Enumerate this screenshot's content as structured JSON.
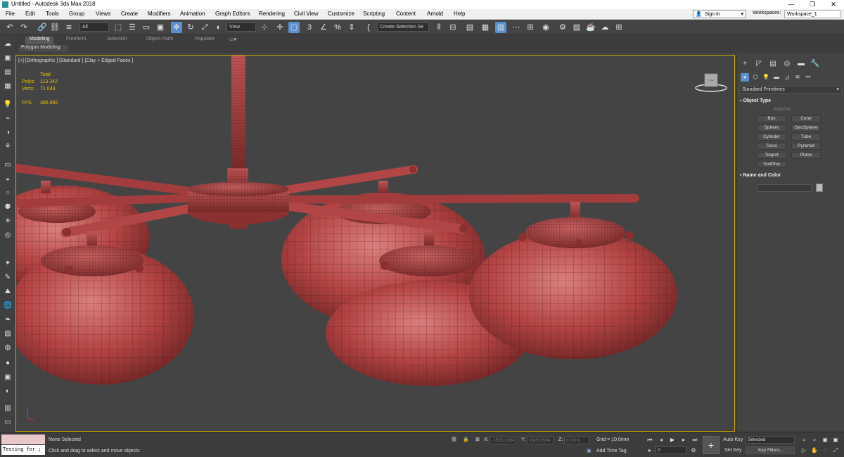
{
  "window": {
    "title": "Untitled - Autodesk 3ds Max 2018",
    "minimize": "—",
    "maximize": "❐",
    "close": "✕"
  },
  "menu": [
    "File",
    "Edit",
    "Tools",
    "Group",
    "Views",
    "Create",
    "Modifiers",
    "Animation",
    "Graph Editors",
    "Rendering",
    "Civil View",
    "Customize",
    "Scripting",
    "Content",
    "Arnold",
    "Help"
  ],
  "account": {
    "signin": "Sign In",
    "workspaces_label": "Workspaces:",
    "workspace": "Workspace_1"
  },
  "toolbar": {
    "selection_filter": "All",
    "ref_coord": "View",
    "named_sel": "Create Selection Se"
  },
  "ribbon": {
    "tabs": [
      "Modeling",
      "Freeform",
      "Selection",
      "Object Paint",
      "Populate"
    ],
    "active": "Modeling",
    "sub": "Polygon Modeling"
  },
  "viewport": {
    "label": "[+] [Orthographic ] [Standard ] [Clay + Edged Faces ]",
    "stats": {
      "total_label": "Total",
      "polys_label": "Polys:",
      "polys": "113 342",
      "verts_label": "Verts:",
      "verts": "71 043",
      "fps_label": "FPS:",
      "fps": "386,982"
    },
    "mesh_color": "#b84a4a"
  },
  "command_panel": {
    "category": "Standard Primitives",
    "object_type_title": "Object Type",
    "autogrid": "AutoGrid",
    "buttons": [
      "Box",
      "Cone",
      "Sphere",
      "GeoSphere",
      "Cylinder",
      "Tube",
      "Torus",
      "Pyramid",
      "Teapot",
      "Plane",
      "TextPlus"
    ],
    "name_color_title": "Name and Color"
  },
  "status": {
    "maxscript": "Testing for ;",
    "none_selected": "None Selected",
    "prompt": "Click and drag to select and move objects",
    "x_label": "X:",
    "x": "-15552,664",
    "y_label": "Y:",
    "y": "9028,5584",
    "z_label": "Z:",
    "z": "0,0mm",
    "grid": "Grid = 10,0mm",
    "add_time_tag": "Add Time Tag",
    "frame": "0",
    "auto_key": "Auto Key",
    "set_key": "Set Key",
    "selected": "Selected",
    "key_filters": "Key Filters..."
  }
}
